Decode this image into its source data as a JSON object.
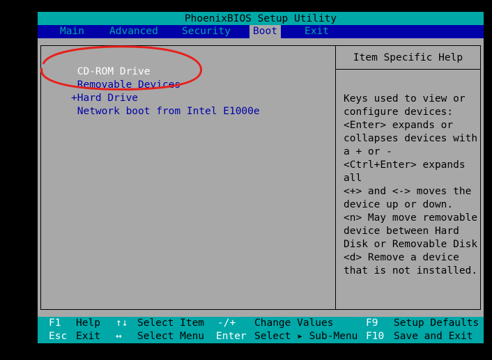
{
  "title": "PhoenixBIOS Setup Utility",
  "menu": [
    {
      "label": "Main"
    },
    {
      "label": "Advanced"
    },
    {
      "label": "Security"
    },
    {
      "label": "Boot",
      "active": true
    },
    {
      "label": "Exit"
    }
  ],
  "boot_list": [
    {
      "label": " CD-ROM Drive",
      "selected": true
    },
    {
      "label": " Removable Devices"
    },
    {
      "label": "+Hard Drive"
    },
    {
      "label": " Network boot from Intel E1000e"
    }
  ],
  "help": {
    "title": "Item Specific Help",
    "lines": [
      "Keys used to view or",
      "configure devices:",
      "<Enter> expands or",
      "collapses devices with",
      "a + or -",
      "<Ctrl+Enter> expands",
      "all",
      "<+> and <-> moves the",
      "device up or down.",
      "<n> May move removable",
      "device between Hard",
      "Disk or Removable Disk",
      "<d> Remove a device",
      "that is not installed."
    ]
  },
  "footer": {
    "row1": [
      {
        "key": "F1",
        "desc": "Help"
      },
      {
        "key": "↑↓",
        "desc": "Select Item"
      },
      {
        "key": "-/+",
        "desc": "Change Values"
      },
      {
        "key": "F9",
        "desc": "Setup Defaults"
      }
    ],
    "row2": [
      {
        "key": "Esc",
        "desc": "Exit"
      },
      {
        "key": "↔",
        "desc": "Select Menu"
      },
      {
        "key": "Enter",
        "desc": "Select ▸ Sub-Menu"
      },
      {
        "key": "F10",
        "desc": "Save and Exit"
      }
    ]
  },
  "colors": {
    "background": "#000000",
    "panel": "#a8a8a8",
    "menubar": "#0000a8",
    "title_bar": "#00a8a8",
    "annotation": "#e8201c"
  }
}
